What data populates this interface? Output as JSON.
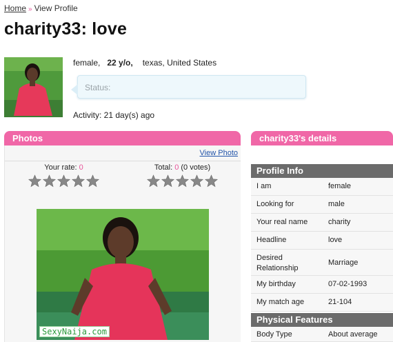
{
  "breadcrumb": {
    "home": "Home",
    "sep": "»",
    "current": "View Profile"
  },
  "profile": {
    "title": "charity33: love",
    "gender": "female,",
    "age": "22 y/o,",
    "location": "texas, United States",
    "status_label": "Status:",
    "activity": "Activity: 21 day(s) ago"
  },
  "photos": {
    "header": "Photos",
    "view_photo": "View Photo",
    "your_rate_label": "Your rate:",
    "your_rate_value": "0",
    "total_label": "Total:",
    "total_value": "0",
    "votes_text": "(0 votes)",
    "watermark": "SexyNaija.com"
  },
  "details": {
    "header": "charity33's details",
    "profile_info_title": "Profile Info",
    "profile_info": [
      {
        "key": "I am",
        "value": "female"
      },
      {
        "key": "Looking for",
        "value": "male"
      },
      {
        "key": "Your real name",
        "value": "charity"
      },
      {
        "key": "Headline",
        "value": "love"
      },
      {
        "key": "Desired Relationship",
        "value": "Marriage"
      },
      {
        "key": "My birthday",
        "value": "07-02-1993"
      },
      {
        "key": "My match age",
        "value": "21-104"
      }
    ],
    "physical_title": "Physical Features",
    "physical": [
      {
        "key": "Body Type",
        "value": "About average"
      }
    ]
  },
  "colors": {
    "accent_pink": "#f067a7",
    "section_gray": "#6b6b6b",
    "link_blue": "#2255aa"
  },
  "icons": {
    "star": "star-icon"
  }
}
